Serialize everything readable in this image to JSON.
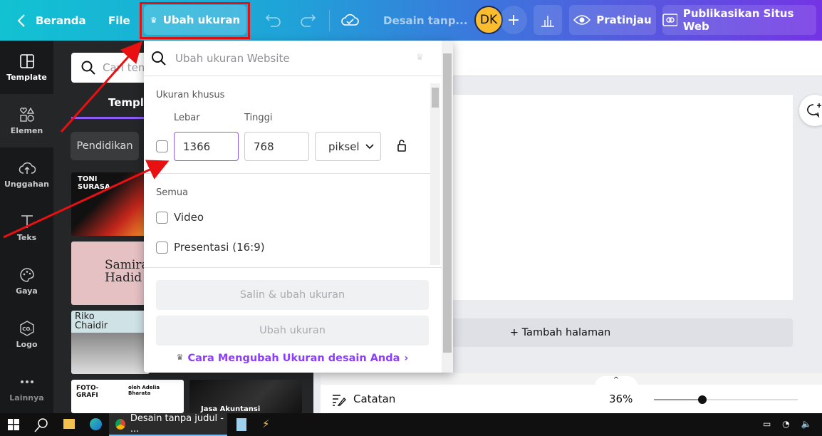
{
  "topbar": {
    "home": "Beranda",
    "file": "File",
    "resize": "Ubah ukuran",
    "title": "Desain tanp...",
    "avatar": "DK",
    "preview": "Pratinjau",
    "publish": "Publikasikan Situs Web"
  },
  "sidebar": {
    "items": [
      {
        "label": "Template",
        "icon": "template-icon"
      },
      {
        "label": "Elemen",
        "icon": "shapes-icon"
      },
      {
        "label": "Unggahan",
        "icon": "cloud-upload-icon"
      },
      {
        "label": "Teks",
        "icon": "text-icon"
      },
      {
        "label": "Gaya",
        "icon": "palette-icon"
      },
      {
        "label": "Logo",
        "icon": "logo-icon"
      },
      {
        "label": "Lainnya",
        "icon": "more-icon"
      }
    ]
  },
  "panel": {
    "search_placeholder": "Cari tem",
    "tab": "Templa",
    "chip": "Pendidikan",
    "thumbs": [
      "TONI SURASA",
      "Samira Hadid",
      "Riko Chaidir",
      "FOTO-GRAFI",
      "oleh Adelia Bharata",
      "Jasa Akuntansi"
    ]
  },
  "dropdown": {
    "search_placeholder": "Ubah ukuran Website",
    "custom_label": "Ukuran khusus",
    "width_label": "Lebar",
    "height_label": "Tinggi",
    "width": "1366",
    "height": "768",
    "unit": "piksel",
    "all_label": "Semua",
    "options": [
      "Video",
      "Presentasi (16:9)"
    ],
    "copy_resize": "Salin & ubah ukuran",
    "resize": "Ubah ukuran",
    "help_link": "Cara Mengubah Ukuran desain Anda"
  },
  "canvas": {
    "add_page": "+ Tambah halaman"
  },
  "bottombar": {
    "notes": "Catatan",
    "zoom": "36%",
    "zoom_level": 0.36
  },
  "taskbar": {
    "chrome_tab": "Desain tanpa judul - ..."
  },
  "colors": {
    "accent": "#7d2ae8",
    "annotation": "#e81010"
  }
}
